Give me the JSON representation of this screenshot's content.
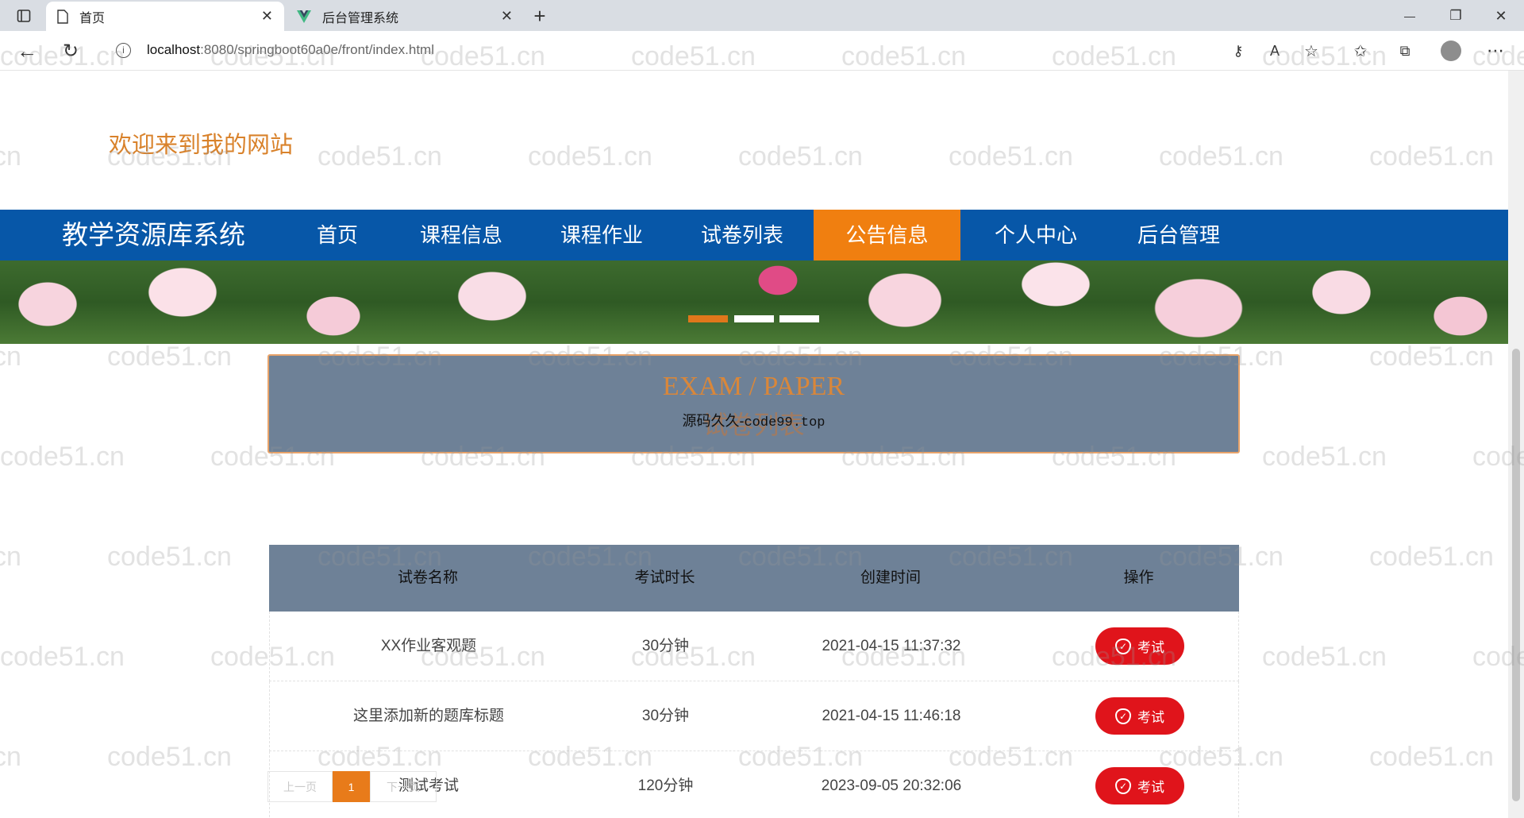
{
  "browser": {
    "tabs": [
      {
        "title": "首页",
        "active": true
      },
      {
        "title": "后台管理系统",
        "active": false
      }
    ],
    "new_tab": "+",
    "url_host": "localhost",
    "url_rest": ":8080/springboot60a0e/front/index.html",
    "window_controls": {
      "minimize": "—",
      "restore": "❐",
      "close": "✕"
    }
  },
  "header": {
    "welcome": "欢迎来到我的网站"
  },
  "nav": {
    "brand": "教学资源库系统",
    "items": [
      {
        "label": "首页",
        "active": false
      },
      {
        "label": "课程信息",
        "active": false
      },
      {
        "label": "课程作业",
        "active": false
      },
      {
        "label": "试卷列表",
        "active": false
      },
      {
        "label": "公告信息",
        "active": true
      },
      {
        "label": "个人中心",
        "active": false
      },
      {
        "label": "后台管理",
        "active": false
      }
    ]
  },
  "carousel": {
    "slides": 3,
    "active_index": 0
  },
  "section": {
    "title_en": "EXAM / PAPER",
    "title_cn": "试卷列表",
    "overlay_text": "源码久久-",
    "overlay_code": "code99.top"
  },
  "table": {
    "columns": [
      "试卷名称",
      "考试时长",
      "创建时间",
      "操作"
    ],
    "rows": [
      {
        "name": "XX作业客观题",
        "duration": "30分钟",
        "created": "2021-04-15 11:37:32",
        "action": "考试"
      },
      {
        "name": "这里添加新的题库标题",
        "duration": "30分钟",
        "created": "2021-04-15 11:46:18",
        "action": "考试"
      },
      {
        "name": "测试考试",
        "duration": "120分钟",
        "created": "2023-09-05 20:32:06",
        "action": "考试"
      }
    ]
  },
  "pagination": {
    "prev": "上一页",
    "current": "1",
    "next": "下一页"
  },
  "watermark": "code51.cn",
  "colors": {
    "nav_bg": "#0757a8",
    "nav_active": "#f07f10",
    "accent_orange": "#d9822b",
    "header_gray": "#6e8197",
    "exam_red": "#e0141b"
  }
}
